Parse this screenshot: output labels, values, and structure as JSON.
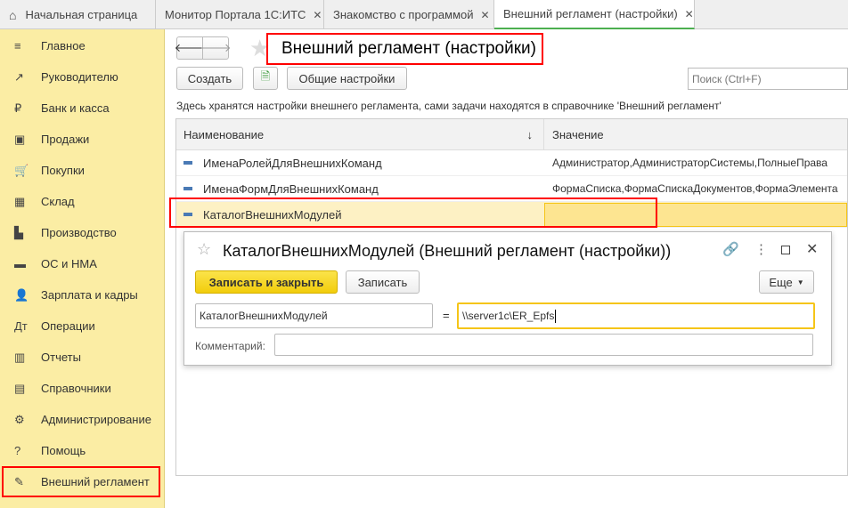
{
  "tabs": [
    {
      "label": "Начальная страница"
    },
    {
      "label": "Монитор Портала 1С:ИТС"
    },
    {
      "label": "Знакомство с программой"
    },
    {
      "label": "Внешний регламент (настройки)"
    }
  ],
  "sidebar": {
    "items": [
      {
        "label": "Главное",
        "icon": "≡"
      },
      {
        "label": "Руководителю",
        "icon": "↗"
      },
      {
        "label": "Банк и касса",
        "icon": "₽"
      },
      {
        "label": "Продажи",
        "icon": "▣"
      },
      {
        "label": "Покупки",
        "icon": "🛒"
      },
      {
        "label": "Склад",
        "icon": "▦"
      },
      {
        "label": "Производство",
        "icon": "▙"
      },
      {
        "label": "ОС и НМА",
        "icon": "▬"
      },
      {
        "label": "Зарплата и кадры",
        "icon": "👤"
      },
      {
        "label": "Операции",
        "icon": "Дт"
      },
      {
        "label": "Отчеты",
        "icon": "▥"
      },
      {
        "label": "Справочники",
        "icon": "▤"
      },
      {
        "label": "Администрирование",
        "icon": "⚙"
      },
      {
        "label": "Помощь",
        "icon": "?"
      },
      {
        "label": "Внешний регламент",
        "icon": "✎"
      }
    ]
  },
  "page": {
    "title": "Внешний регламент (настройки)",
    "create": "Создать",
    "general_settings": "Общие настройки",
    "search_placeholder": "Поиск (Ctrl+F)",
    "info": "Здесь хранятся настройки внешнего регламента, сами задачи находятся в справочнике 'Внешний регламент'"
  },
  "grid": {
    "headers": [
      "Наименование",
      "Значение"
    ],
    "sort_icon": "↓",
    "rows": [
      {
        "name": "ИменаРолейДляВнешнихКоманд",
        "value": "Администратор,АдминистраторСистемы,ПолныеПрава"
      },
      {
        "name": "ИменаФормДляВнешнихКоманд",
        "value": "ФормаСписка,ФормаСпискаДокументов,ФормаЭлемента"
      },
      {
        "name": "КаталогВнешнихМодулей",
        "value": ""
      }
    ]
  },
  "dialog": {
    "title": "КаталогВнешнихМодулей (Внешний регламент (настройки))",
    "save_close": "Записать и закрыть",
    "save": "Записать",
    "more": "Еще",
    "name_value": "КаталогВнешнихМодулей",
    "eq": "=",
    "value": "\\\\server1c\\ER_Epfs",
    "comment_label": "Комментарий:",
    "comment_value": ""
  },
  "colors": {
    "sidebar": "#fbeda4",
    "accent": "#f5d327",
    "highlight": "#ff0000"
  }
}
